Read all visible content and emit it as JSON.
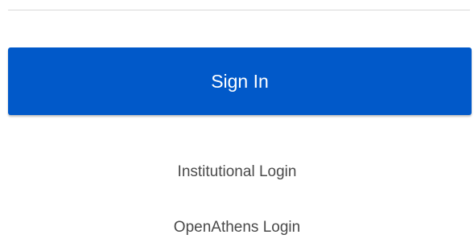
{
  "form": {
    "sign_in_label": "Sign In"
  },
  "links": {
    "institutional_login": "Institutional Login",
    "openathens_login": "OpenAthens Login"
  },
  "colors": {
    "primary_button": "#0159c9",
    "link_text": "#4a4a4a"
  }
}
